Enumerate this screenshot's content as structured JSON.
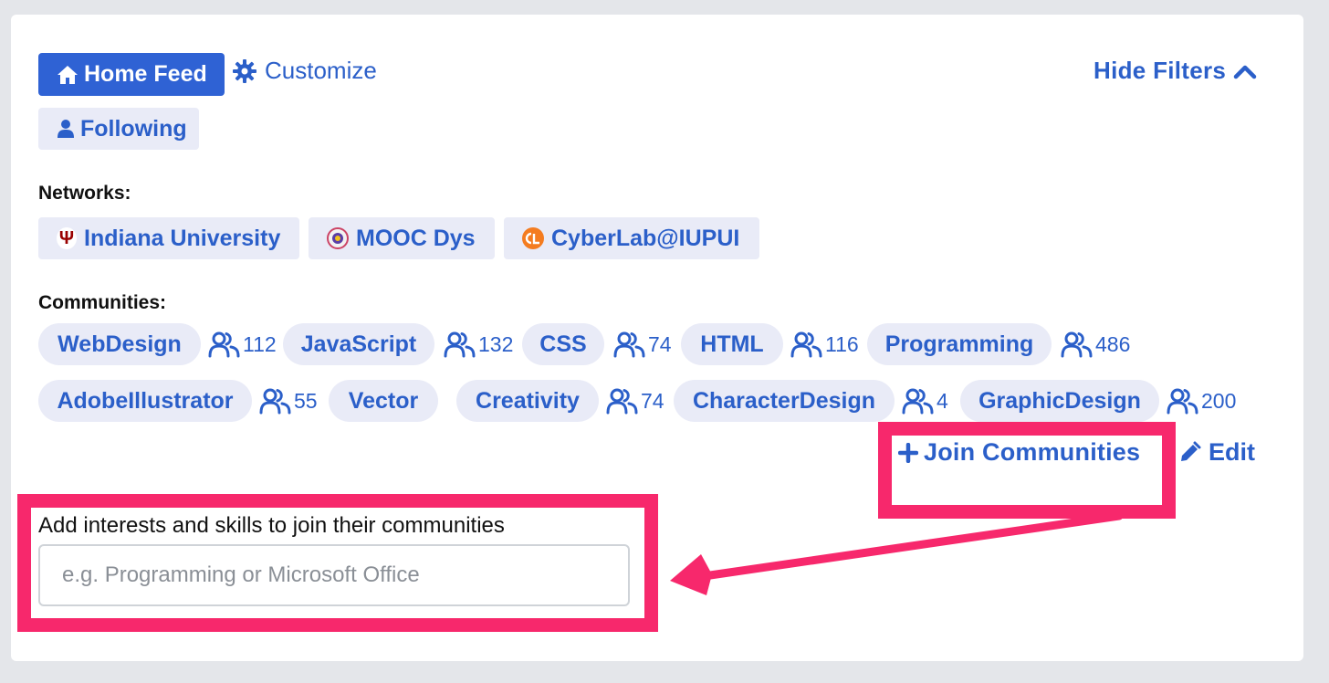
{
  "header": {
    "home_feed": "Home Feed",
    "customize": "Customize",
    "following": "Following",
    "hide_filters": "Hide Filters"
  },
  "networks": {
    "label": "Networks:",
    "items": [
      {
        "name": "Indiana University"
      },
      {
        "name": "MOOC Dys"
      },
      {
        "name": "CyberLab@IUPUI"
      }
    ]
  },
  "communities": {
    "label": "Communities:",
    "items": [
      {
        "name": "WebDesign",
        "count": "112"
      },
      {
        "name": "JavaScript",
        "count": "132"
      },
      {
        "name": "CSS",
        "count": "74"
      },
      {
        "name": "HTML",
        "count": "116"
      },
      {
        "name": "Programming",
        "count": "486"
      },
      {
        "name": "AdobeIllustrator",
        "count": "55"
      },
      {
        "name": "Vector",
        "count": ""
      },
      {
        "name": "Creativity",
        "count": "74"
      },
      {
        "name": "CharacterDesign",
        "count": "4"
      },
      {
        "name": "GraphicDesign",
        "count": "200"
      }
    ]
  },
  "actions": {
    "join_communities": "Join Communities",
    "edit": "Edit"
  },
  "interests": {
    "label": "Add interests and skills to join their communities",
    "placeholder": "e.g. Programming or Microsoft Office",
    "value": ""
  },
  "colors": {
    "accent": "#2f62d4",
    "link": "#2b5fc9",
    "chip_bg": "#e9ebf7",
    "highlight": "#f7286c"
  },
  "icons": [
    "home-icon",
    "gear-icon",
    "user-icon",
    "chevron-up-icon",
    "users-icon",
    "plus-icon",
    "pencil-icon"
  ]
}
